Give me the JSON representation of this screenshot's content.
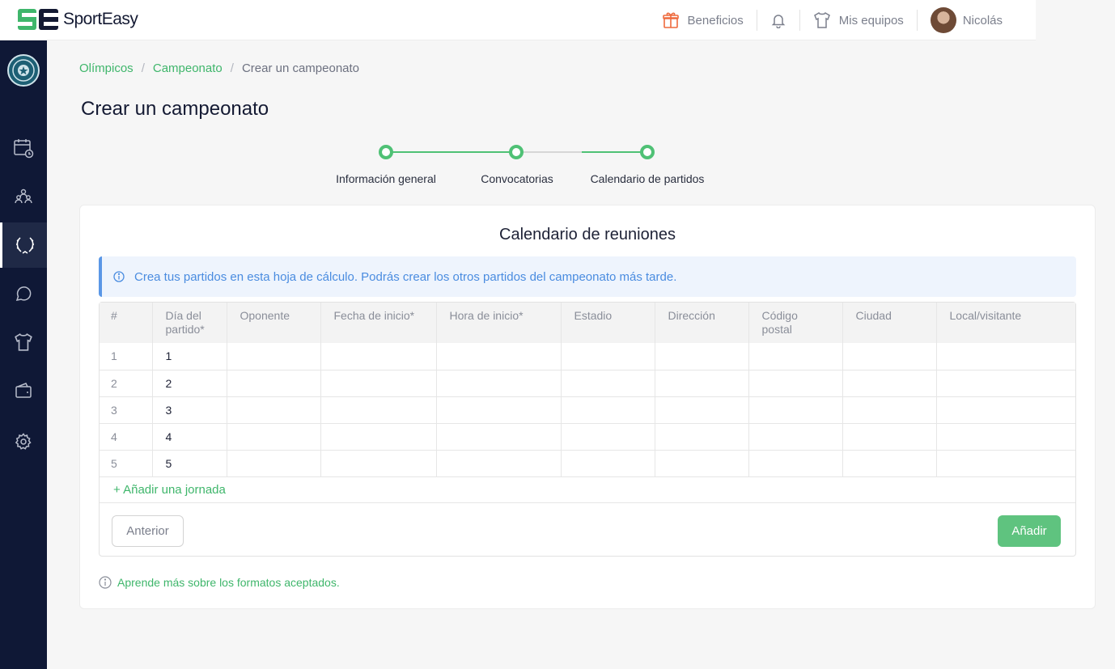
{
  "brand": {
    "name": "SportEasy",
    "mark_text": "SE"
  },
  "topbar": {
    "benefits_label": "Beneficios",
    "teams_label": "Mis equipos",
    "user_name": "Nicolás"
  },
  "breadcrumb": [
    "Olímpicos",
    "Campeonato",
    "Crear un campeonato"
  ],
  "page_title": "Crear un campeonato",
  "stepper": {
    "steps": [
      "Información general",
      "Convocatorias",
      "Calendario de partidos"
    ],
    "current_step": 3
  },
  "card": {
    "title": "Calendario de reuniones",
    "info": "Crea tus partidos en esta hoja de cálculo. Podrás crear los otros partidos del campeonato más tarde.",
    "columns": [
      "#",
      "Día del partido*",
      "Oponente",
      "Fecha de inicio*",
      "Hora de inicio*",
      "Estadio",
      "Dirección",
      "Código postal",
      "Ciudad",
      "Local/visitante"
    ],
    "rows": [
      [
        "1",
        "1",
        "",
        "",
        "",
        "",
        "",
        "",
        "",
        ""
      ],
      [
        "2",
        "2",
        "",
        "",
        "",
        "",
        "",
        "",
        "",
        ""
      ],
      [
        "3",
        "3",
        "",
        "",
        "",
        "",
        "",
        "",
        "",
        ""
      ],
      [
        "4",
        "4",
        "",
        "",
        "",
        "",
        "",
        "",
        "",
        ""
      ],
      [
        "5",
        "5",
        "",
        "",
        "",
        "",
        "",
        "",
        "",
        ""
      ]
    ],
    "add_row_label": "+ Añadir una jornada",
    "prev_button": "Anterior",
    "add_button": "Añadir",
    "learn_more": "Aprende más sobre los formatos aceptados."
  },
  "sidebar": {
    "items": [
      "calendar-icon",
      "members-icon",
      "championship-icon",
      "chat-icon",
      "jersey-icon",
      "wallet-icon",
      "settings-icon"
    ],
    "active": "championship-icon"
  },
  "colors": {
    "accent": "#4fc175",
    "sidebar": "#0f1836",
    "info": "#4a8ce0"
  }
}
